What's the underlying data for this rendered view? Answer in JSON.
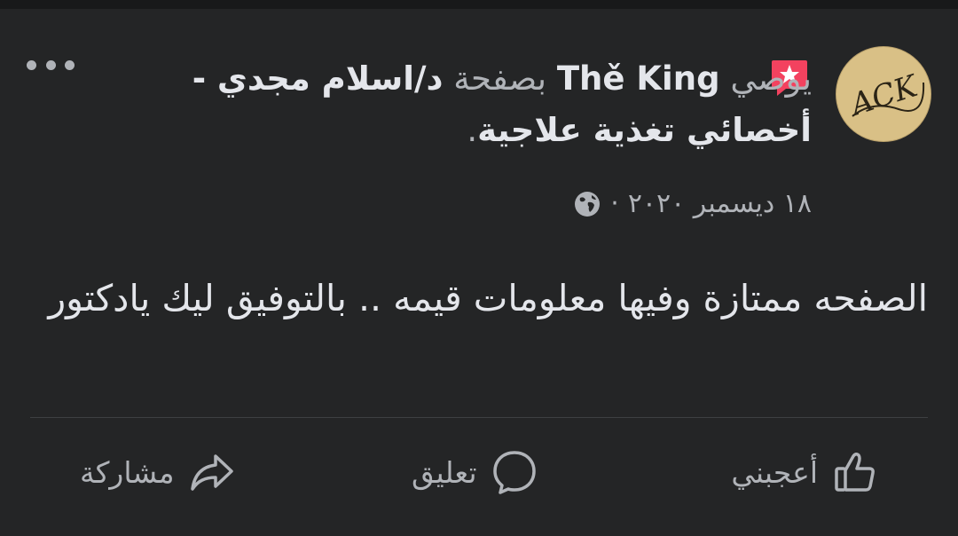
{
  "post": {
    "author": "Thě King",
    "verb": "يوصي",
    "connector": "بصفحة",
    "page_name": "د/اسلام مجدي - أخصائي تغذية علاجية",
    "period": ".",
    "avatar_text": "ACK",
    "date": "١٨ ديسمبر ٢٠٢٠",
    "separator": "·",
    "body": "الصفحه ممتازة وفيها معلومات قيمه .. بالتوفيق ليك يادكتور"
  },
  "actions": {
    "like": "أعجبني",
    "comment": "تعليق",
    "share": "مشاركة"
  },
  "icons": {
    "recommend": "recommend-badge-icon",
    "privacy": "globe-icon",
    "more": "more-dots-icon",
    "like": "thumbs-up-icon",
    "comment": "comment-bubble-icon",
    "share": "share-arrow-icon"
  },
  "colors": {
    "background": "#242526",
    "text": "#e4e6eb",
    "muted": "#b0b3b8",
    "recommend_badge": "#f3425f"
  }
}
